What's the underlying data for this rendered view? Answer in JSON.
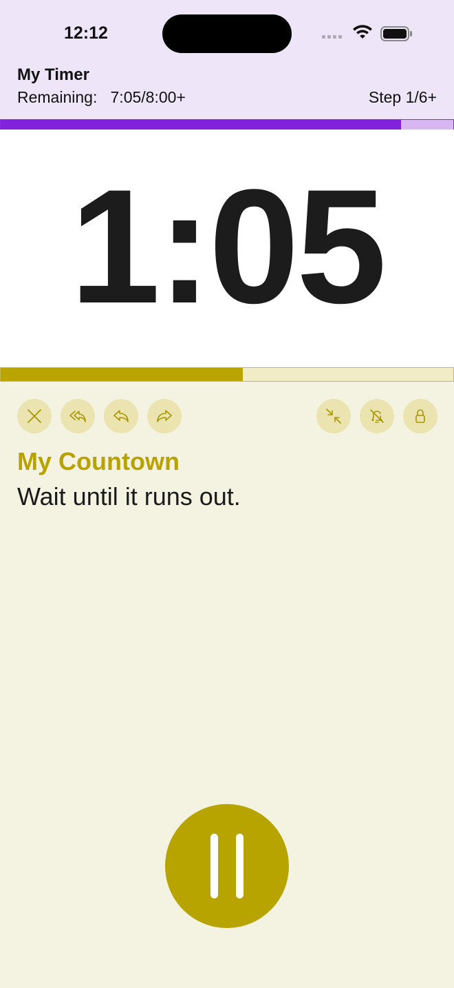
{
  "status_bar": {
    "time": "12:12"
  },
  "header": {
    "title": "My Timer",
    "remaining": "Remaining:   7:05/8:00+",
    "step": "Step 1/6+"
  },
  "overall_progress": 0.885,
  "step_progress": 0.535,
  "timer": {
    "display": "1:05"
  },
  "controls": {
    "left": [
      "close-icon",
      "rewind-all-icon",
      "back-icon",
      "forward-icon"
    ],
    "right": [
      "collapse-icon",
      "mute-icon",
      "lock-icon"
    ]
  },
  "current_step": {
    "title": "My Countown",
    "description": "Wait until it runs out."
  },
  "colors": {
    "purple": "#8122dc",
    "gold": "#b9a400",
    "background": "#f4f2e1"
  },
  "main_button": {
    "icon": "pause-icon"
  }
}
